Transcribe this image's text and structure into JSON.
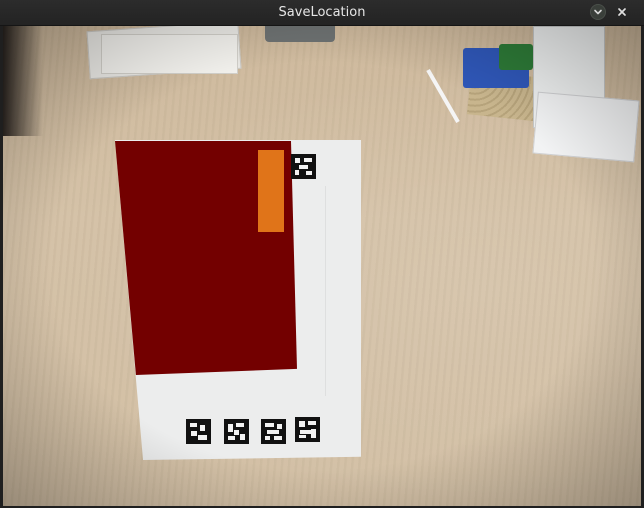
{
  "window": {
    "title": "SaveLocation",
    "controls": {
      "minimize_icon": "chevron-down-icon",
      "close_icon": "close-icon"
    }
  },
  "scene": {
    "description_colors": {
      "red_region": "#730000",
      "orange_bar": "#e07419",
      "sheet": "#eceded"
    },
    "marker_icons": [
      "marker-pattern-top",
      "marker-pattern-1",
      "marker-pattern-2",
      "marker-pattern-3",
      "marker-pattern-4"
    ]
  }
}
